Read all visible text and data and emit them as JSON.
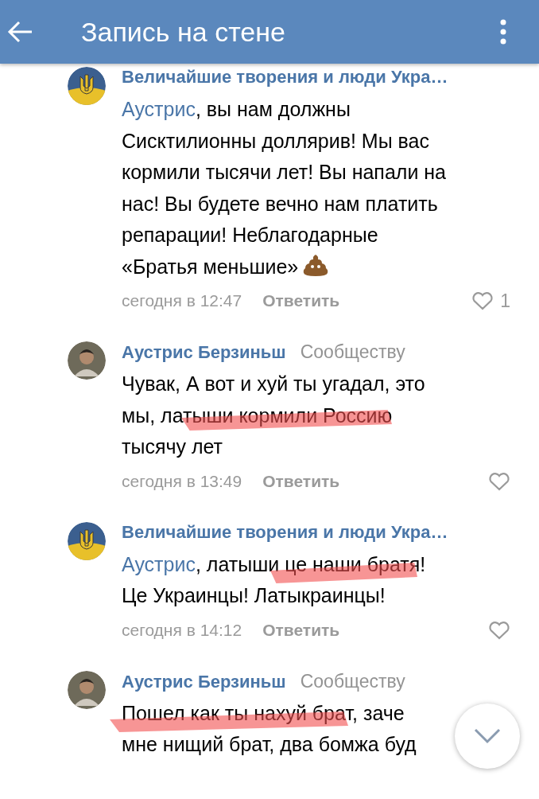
{
  "header": {
    "title": "Запись на стене"
  },
  "comments": [
    {
      "kind": "group",
      "author": "Величайшие творения и люди Укра…",
      "mention": "Аустрис",
      "body": ", вы нам должны\nСисктилионны доллярив! Мы вас\nкормили тысячи лет! Вы напали на\nнас! Вы будете вечно нам платить\nрепарации! Неблагодарные\n«Братья меньшие»",
      "emoji": true,
      "time": "сегодня в 12:47",
      "reply": "Ответить",
      "likes": "1",
      "scribbled": false
    },
    {
      "kind": "person",
      "author": "Аустрис Берзиньш",
      "target": "Сообществу",
      "body": "Чувак, А вот и хуй ты угадал, это\nмы, латыши кормили Россию\nтысячу лет",
      "emoji": false,
      "time": "сегодня в 13:49",
      "reply": "Ответить",
      "scribbled": true
    },
    {
      "kind": "group",
      "author": "Величайшие творения и люди Укра…",
      "mention": "Аустрис",
      "body": ", латыши це наши братя!\nЦе Украинцы! Латыкраинцы!",
      "emoji": false,
      "time": "сегодня в 14:12",
      "reply": "Ответить",
      "scribbled": true
    },
    {
      "kind": "person",
      "author": "Аустрис Берзиньш",
      "target": "Сообществу",
      "body": "Пошел как ты нахуй брат, заче\nмне нищий брат, два бомжа буд",
      "emoji": false,
      "scribbled": true
    }
  ]
}
